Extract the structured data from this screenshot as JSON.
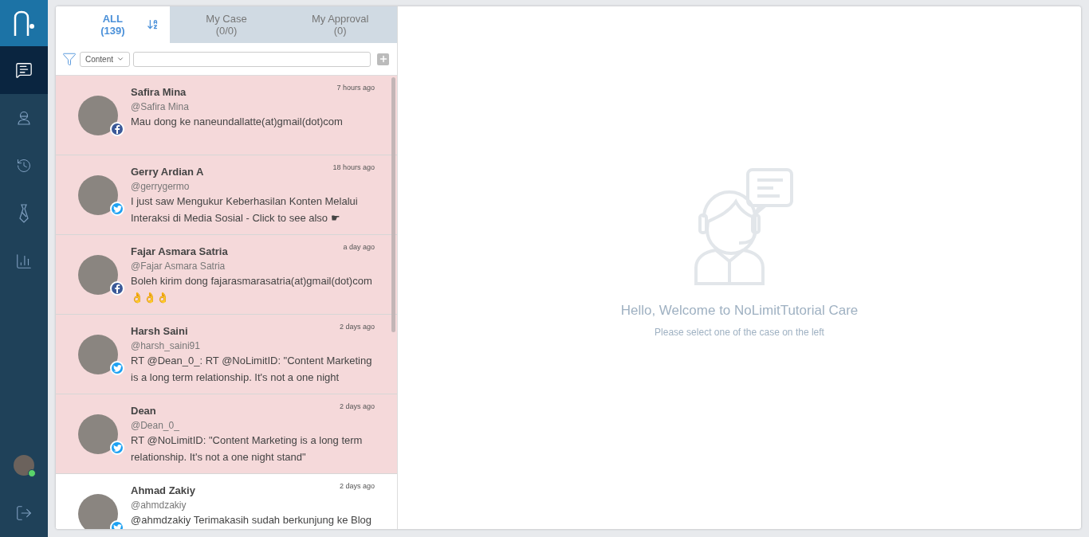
{
  "sidebar": {
    "items": [
      {
        "kind": "chat",
        "selected": true
      },
      {
        "kind": "agent",
        "selected": false
      },
      {
        "kind": "history",
        "selected": false
      },
      {
        "kind": "tie",
        "selected": false
      },
      {
        "kind": "chart",
        "selected": false
      }
    ],
    "user": {
      "online": true
    }
  },
  "tabs": [
    {
      "label": "ALL",
      "count": "(139)",
      "selected": true
    },
    {
      "label": "My Case",
      "count": "(0/0)",
      "selected": false
    },
    {
      "label": "My Approval",
      "count": "(0)",
      "selected": false
    }
  ],
  "filter": {
    "dropdown": "Content"
  },
  "cases": [
    {
      "name": "Safira Mina",
      "handle": "@Safira Mina",
      "time": "7 hours ago",
      "message": "Mau dong ke naneundallatte(at)gmail(dot)com",
      "kind": "facebook",
      "unread": true
    },
    {
      "name": "Gerry Ardian A",
      "handle": "@gerrygermo",
      "time": "18 hours ago",
      "message": "I just saw Mengukur Keberhasilan Konten Melalui Interaksi di Media Sosial - Click to see also ☛",
      "kind": "twitter",
      "unread": true
    },
    {
      "name": "Fajar Asmara Satria",
      "handle": "@Fajar Asmara Satria",
      "time": "a day ago",
      "message": "Boleh kirim dong fajarasmarasatria(at)gmail(dot)com 👌👌👌",
      "kind": "facebook",
      "unread": true
    },
    {
      "name": "Harsh Saini",
      "handle": "@harsh_saini91",
      "time": "2 days ago",
      "message": "RT @Dean_0_: RT @NoLimitID: \"Content Marketing is a long term relationship. It's not a one night",
      "kind": "twitter",
      "unread": true
    },
    {
      "name": "Dean",
      "handle": "@Dean_0_",
      "time": "2 days ago",
      "message": "RT @NoLimitID: \"Content Marketing is a long term relationship. It's not a one night stand\"",
      "kind": "twitter",
      "unread": true
    },
    {
      "name": "Ahmad Zakiy",
      "handle": "@ahmdzakiy",
      "time": "2 days ago",
      "message": "@ahmdzakiy Terimakasih sudah berkunjung ke Blog",
      "kind": "twitter",
      "unread": false
    }
  ],
  "welcome": {
    "title": "Hello, Welcome to NoLimitTutorial Care",
    "subtitle": "Please select one of the case on the left"
  }
}
